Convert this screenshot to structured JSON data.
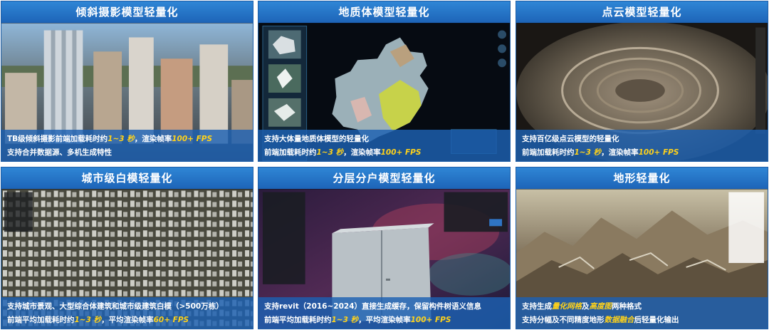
{
  "colors": {
    "title_bar": "#2378c8",
    "caption_bg": "#1c60b2",
    "highlight": "#ffd21a"
  },
  "panels": [
    {
      "title": "倾斜摄影模型轻量化",
      "line1": {
        "a": "TB级倾斜摄影前端加载耗时约",
        "h1": "1~3 秒",
        "b": "，渲染帧率",
        "h2": "100+ FPS",
        "c": ""
      },
      "line2": {
        "a": "支持合并数据源、多机生成特性",
        "h1": "",
        "b": "",
        "h2": "",
        "c": ""
      }
    },
    {
      "title": "地质体模型轻量化",
      "line1": {
        "a": "支持大体量地质体模型的轻量化",
        "h1": "",
        "b": "",
        "h2": "",
        "c": ""
      },
      "line2": {
        "a": "前端加载耗时约",
        "h1": "1~3 秒",
        "b": "，渲染帧率",
        "h2": "100+ FPS",
        "c": ""
      }
    },
    {
      "title": "点云模型轻量化",
      "line1": {
        "a": "支持百亿级点云模型的轻量化",
        "h1": "",
        "b": "",
        "h2": "",
        "c": ""
      },
      "line2": {
        "a": "前端加载耗时约",
        "h1": "1~3 秒",
        "b": "，渲染帧率",
        "h2": "100+ FPS",
        "c": ""
      }
    },
    {
      "title": "城市级白模轻量化",
      "line1": {
        "a": "支持城市景观、大型综合体建筑和城市级建筑白模（>500万栋）",
        "h1": "",
        "b": "",
        "h2": "",
        "c": ""
      },
      "line2": {
        "a": "前端平均加载耗时约",
        "h1": "1~3 秒",
        "b": "，平均渲染帧率",
        "h2": "60+ FPS",
        "c": ""
      }
    },
    {
      "title": "分层分户模型轻量化",
      "line1": {
        "a": "支持revit（2016~2024）直接生成缓存，保留构件树语义信息",
        "h1": "",
        "b": "",
        "h2": "",
        "c": ""
      },
      "line2": {
        "a": "前端平均加载耗时约",
        "h1": "1~3 秒",
        "b": "，平均渲染帧率",
        "h2": "100+ FPS",
        "c": ""
      }
    },
    {
      "title": "地形轻量化",
      "line1": {
        "a": "支持生成",
        "h1": "量化网格",
        "b": "及",
        "h2": "高度图",
        "c": "两种格式"
      },
      "line2": {
        "a": "支持分幅及不同精度地形",
        "h1": "数据融合",
        "b": "后轻量化输出",
        "h2": "",
        "c": ""
      }
    }
  ]
}
